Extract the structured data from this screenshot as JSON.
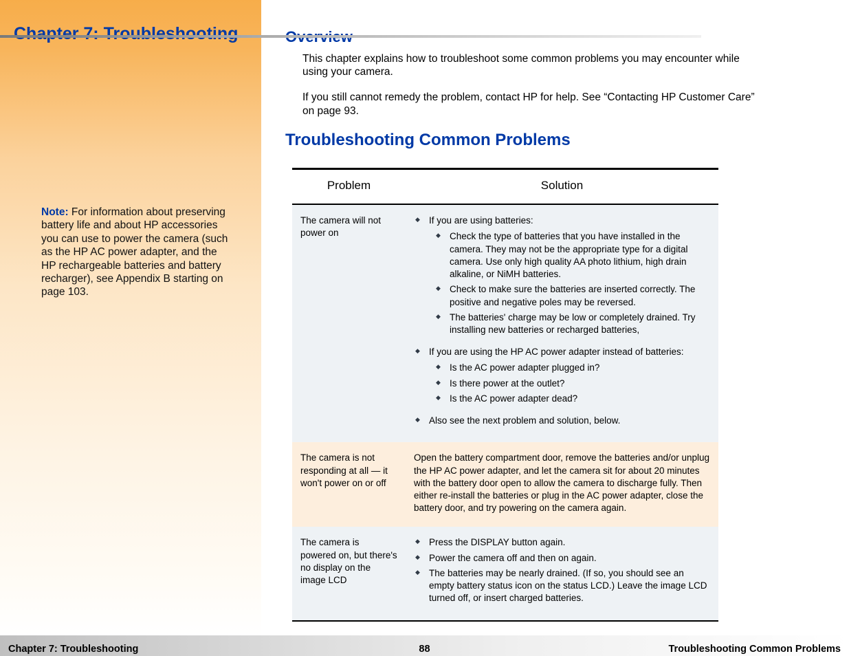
{
  "chapter_title": "Chapter 7: Troubleshooting",
  "note": {
    "label": "Note:",
    "text": " For information about preserving battery life and about HP accessories you can use to power the camera (such as the HP AC power adapter, and the HP rechargeable batteries and battery recharger), see Appendix B starting on page 103."
  },
  "overview": {
    "heading": "Overview",
    "p1": "This chapter explains how to troubleshoot some common problems you may encounter while using your camera.",
    "p2": "If you still cannot remedy the problem, contact HP for help. See “Contacting HP Customer Care” on page 93."
  },
  "troubleshoot_heading": "Troubleshooting Common Problems",
  "table": {
    "head_problem": "Problem",
    "head_solution": "Solution",
    "rows": [
      {
        "problem": "The camera will not power on",
        "solution": [
          {
            "text": "If you are using batteries:",
            "sub": [
              "Check the type of batteries that you have installed in the camera. They may not be the appropriate type for a digital camera. Use only high quality AA photo lithium, high drain alkaline, or NiMH batteries.",
              "Check to make sure the batteries are inserted correctly. The positive and negative poles may be reversed.",
              "The batteries' charge may be low or completely drained. Try installing new batteries or recharged batteries,"
            ]
          },
          {
            "text": "If you are using the HP AC power adapter instead of batteries:",
            "sub": [
              "Is the AC power adapter plugged in?",
              "Is there power at the outlet?",
              "Is the AC power adapter dead?"
            ]
          },
          {
            "text": "Also see the next problem and solution, below."
          }
        ]
      },
      {
        "problem": "The camera is not responding at all — it won't power on or off",
        "solution_text": "Open the battery compartment door, remove the batteries and/or unplug the HP AC power adapter, and let the camera sit for about 20 minutes with the battery door open to allow the camera to discharge fully. Then either re-install the batteries or plug in the AC power adapter, close the battery door, and try powering on the camera again."
      },
      {
        "problem": "The camera is powered on, but there's no display on the image LCD",
        "solution": [
          {
            "text": "Press the DISPLAY button again."
          },
          {
            "text": "Power the camera off and then on again."
          },
          {
            "text": "The batteries may be nearly drained. (If so, you should see an empty battery status icon on the status LCD.) Leave the image LCD turned off, or insert charged batteries."
          }
        ]
      }
    ]
  },
  "footer": {
    "left": "Chapter 7: Troubleshooting",
    "page": "88",
    "right": "Troubleshooting Common Problems"
  }
}
